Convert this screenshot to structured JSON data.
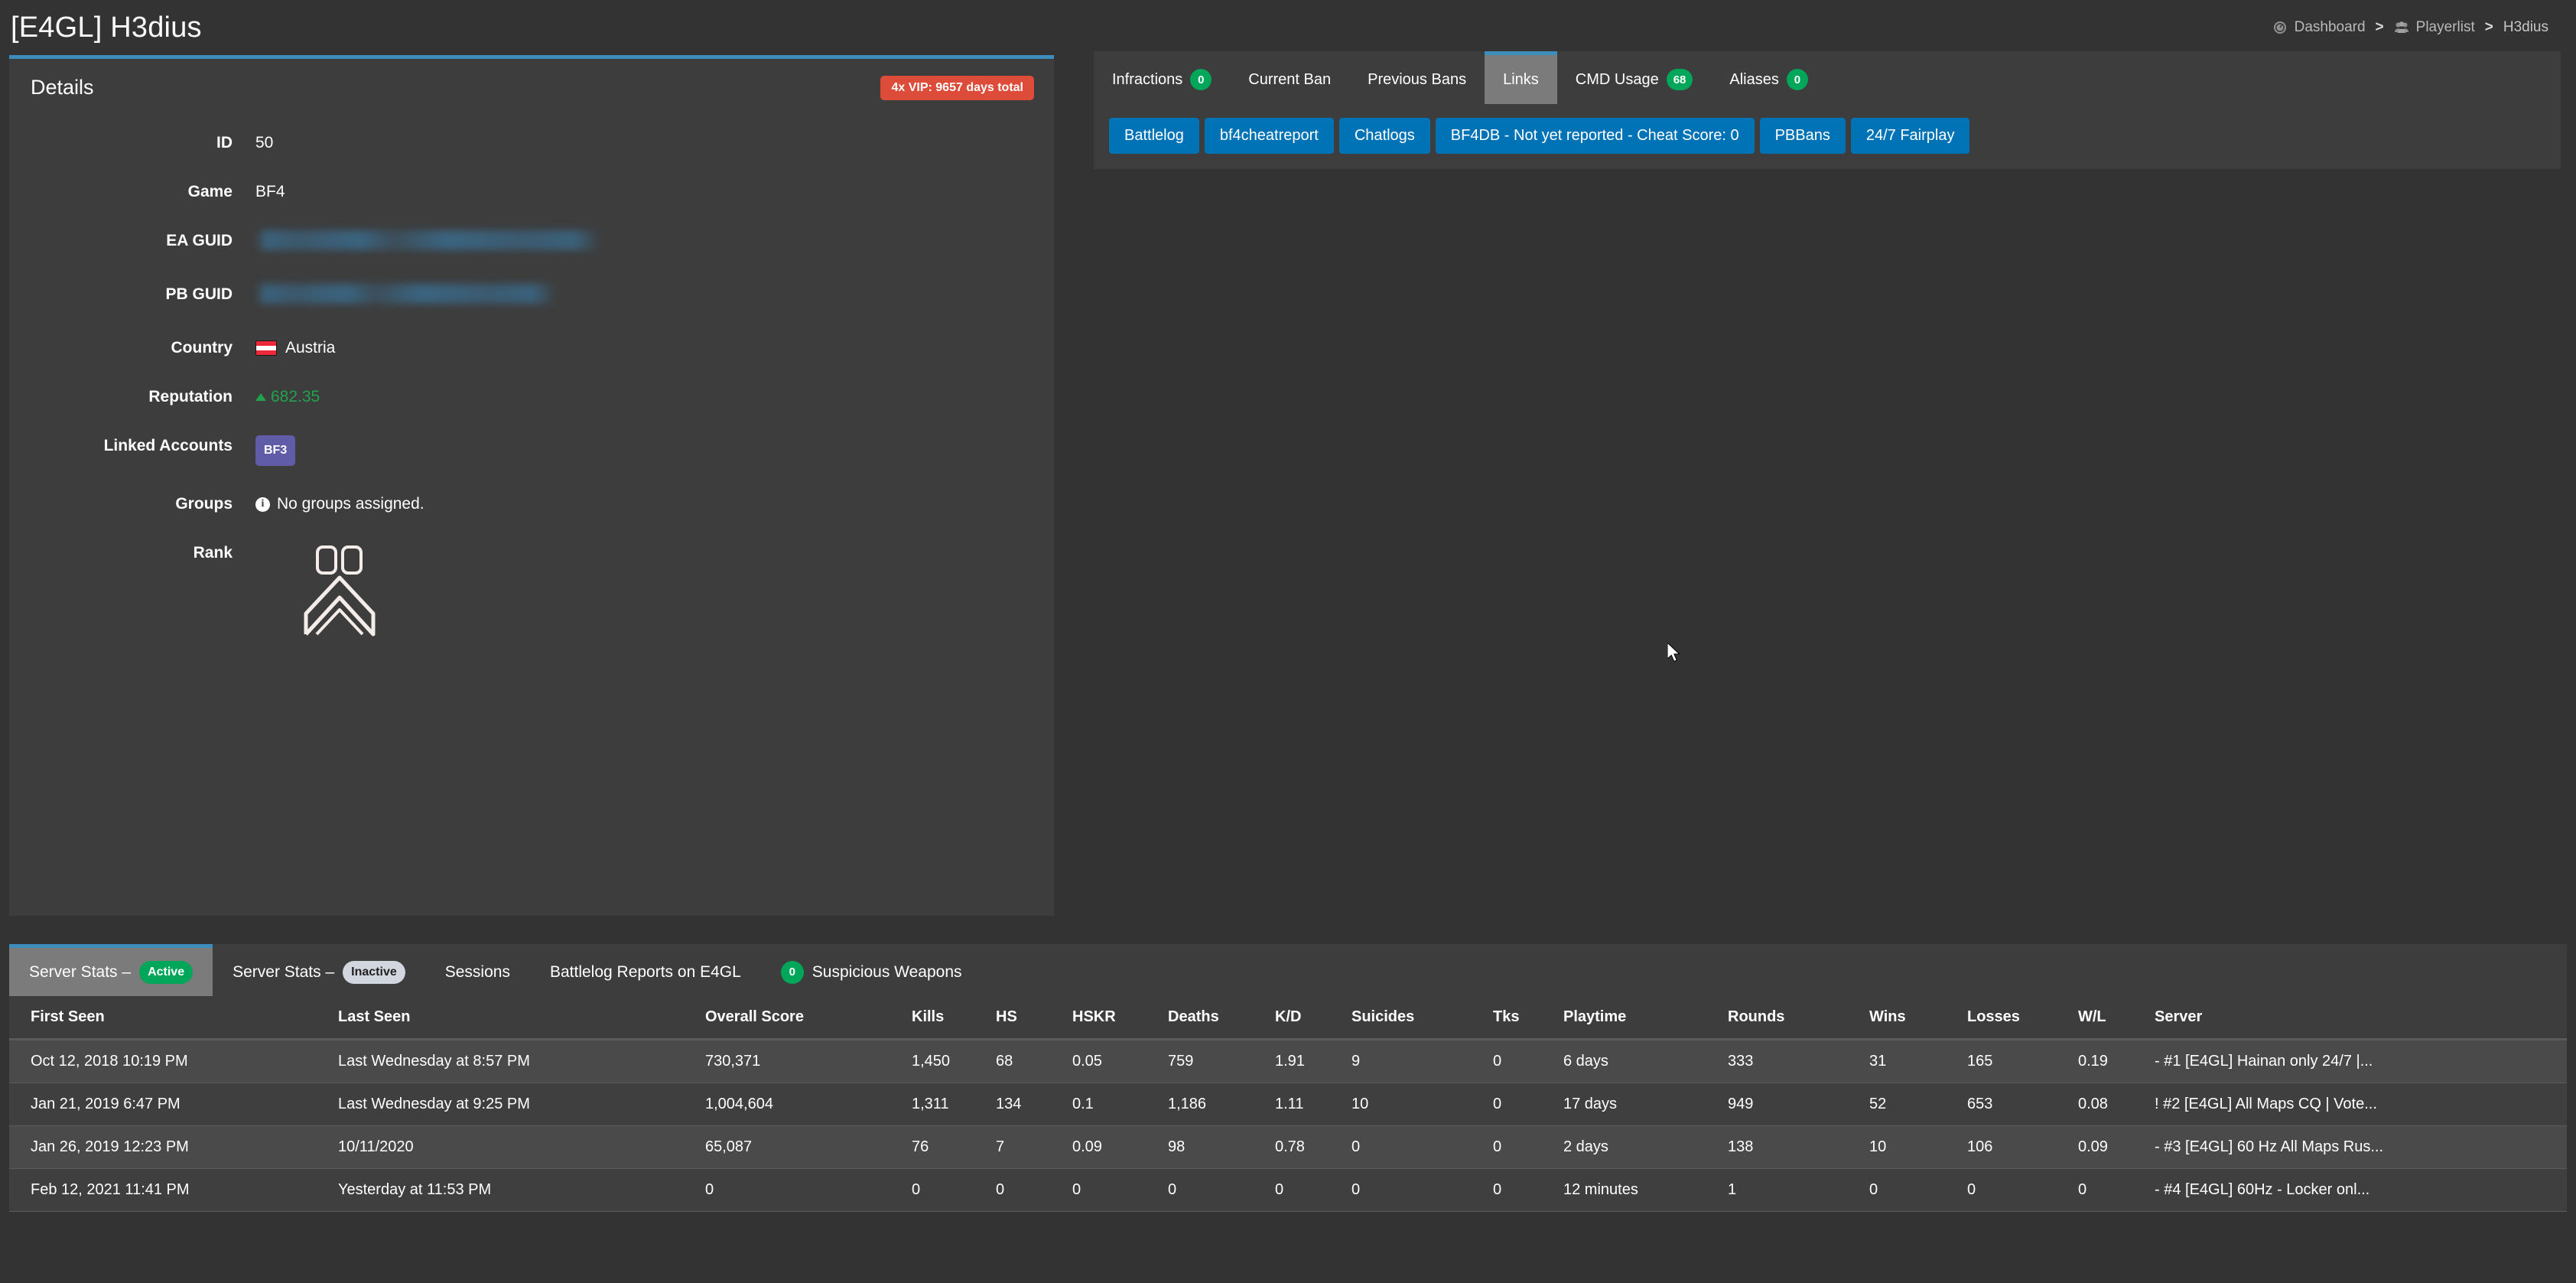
{
  "header": {
    "title": "[E4GL] H3dius",
    "breadcrumb": {
      "dashboard": "Dashboard",
      "separator": ">",
      "playerlist": "Playerlist",
      "current": "H3dius",
      "dashboard_icon": "dashboard-icon",
      "playerlist_icon": "users-icon"
    }
  },
  "details": {
    "panel_title": "Details",
    "vip_badge": "4x VIP: 9657 days total",
    "fields": [
      {
        "label": "ID",
        "value": "50"
      },
      {
        "label": "Game",
        "value": "BF4"
      },
      {
        "label": "EA GUID",
        "value": ""
      },
      {
        "label": "PB GUID",
        "value": ""
      },
      {
        "label": "Country",
        "value": "Austria"
      },
      {
        "label": "Reputation",
        "value": "682.35"
      },
      {
        "label": "Linked Accounts",
        "value": "BF3"
      },
      {
        "label": "Groups",
        "value": "No groups assigned."
      },
      {
        "label": "Rank",
        "value": "00"
      }
    ],
    "country_flag": "austria-flag-icon",
    "reputation_trend": "up",
    "groups_icon": "info-icon",
    "rank_number": "00"
  },
  "right_panel": {
    "tabs": [
      {
        "label": "Infractions",
        "badge": "0",
        "active": false
      },
      {
        "label": "Current Ban",
        "badge": null,
        "active": false
      },
      {
        "label": "Previous Bans",
        "badge": null,
        "active": false
      },
      {
        "label": "Links",
        "badge": null,
        "active": true
      },
      {
        "label": "CMD Usage",
        "badge": "68",
        "active": false
      },
      {
        "label": "Aliases",
        "badge": "0",
        "active": false
      }
    ],
    "links": [
      "Battlelog",
      "bf4cheatreport",
      "Chatlogs",
      "BF4DB - Not yet reported - Cheat Score: 0",
      "PBBans",
      "24/7 Fairplay"
    ]
  },
  "bottom": {
    "tabs": [
      {
        "label": "Server Stats –",
        "badge": "Active",
        "badge_style": "green",
        "active": true
      },
      {
        "label": "Server Stats –",
        "badge": "Inactive",
        "badge_style": "grey",
        "active": false
      },
      {
        "label": "Sessions",
        "badge": null,
        "badge_style": null,
        "active": false
      },
      {
        "label": "Battlelog Reports on E4GL",
        "badge": null,
        "badge_style": null,
        "active": false
      },
      {
        "label": "Suspicious Weapons",
        "badge": "0",
        "badge_style": "green-leading",
        "active": false
      }
    ],
    "table": {
      "columns": [
        "First Seen",
        "Last Seen",
        "Overall Score",
        "Kills",
        "HS",
        "HSKR",
        "Deaths",
        "K/D",
        "Suicides",
        "Tks",
        "Playtime",
        "Rounds",
        "Wins",
        "Losses",
        "W/L",
        "Server"
      ],
      "rows": [
        [
          "Oct 12, 2018 10:19 PM",
          "Last Wednesday at 8:57 PM",
          "730,371",
          "1,450",
          "68",
          "0.05",
          "759",
          "1.91",
          "9",
          "0",
          "6 days",
          "333",
          "31",
          "165",
          "0.19",
          "- #1 [E4GL] Hainan only 24/7 |..."
        ],
        [
          "Jan 21, 2019 6:47 PM",
          "Last Wednesday at 9:25 PM",
          "1,004,604",
          "1,311",
          "134",
          "0.1",
          "1,186",
          "1.11",
          "10",
          "0",
          "17 days",
          "949",
          "52",
          "653",
          "0.08",
          "! #2 [E4GL] All Maps CQ | Vote..."
        ],
        [
          "Jan 26, 2019 12:23 PM",
          "10/11/2020",
          "65,087",
          "76",
          "7",
          "0.09",
          "98",
          "0.78",
          "0",
          "0",
          "2 days",
          "138",
          "10",
          "106",
          "0.09",
          "- #3 [E4GL] 60 Hz All Maps Rus..."
        ],
        [
          "Feb 12, 2021 11:41 PM",
          "Yesterday at 11:53 PM",
          "0",
          "0",
          "0",
          "0",
          "0",
          "0",
          "0",
          "0",
          "12 minutes",
          "1",
          "0",
          "0",
          "0",
          "- #4 [E4GL] 60Hz - Locker onl..."
        ]
      ]
    }
  },
  "colors": {
    "accent_blue": "#3c8dbc",
    "link_blue": "#0073b7",
    "success_green": "#00a65a",
    "danger_red": "#dd4b39",
    "purple": "#605ca8",
    "panel_bg": "#3d3d3d",
    "page_bg": "#333333"
  }
}
